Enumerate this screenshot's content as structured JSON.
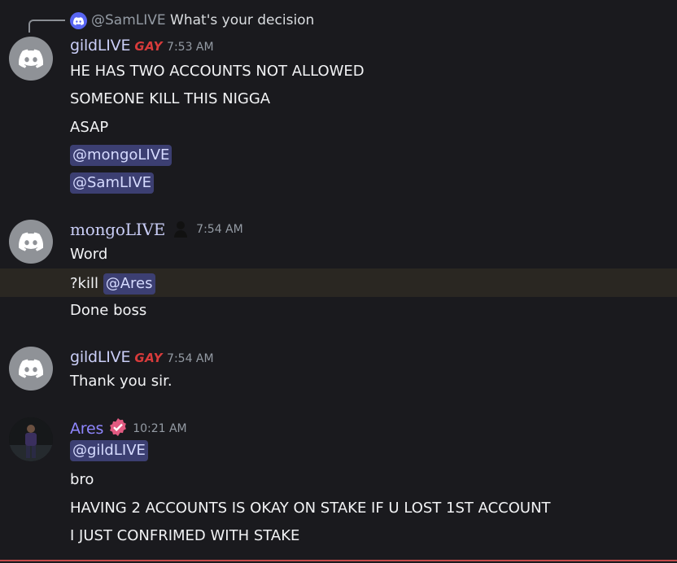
{
  "reply": {
    "mention": "@SamLIVE",
    "text": "What's your decision"
  },
  "messages": [
    {
      "author": "gildLIVE",
      "badge": "GAY",
      "time": "7:53 AM",
      "lines": [
        "HE HAS TWO ACCOUNTS NOT ALLOWED",
        "SOMEONE KILL THIS NIGGA",
        "ASAP"
      ],
      "mentions": [
        "@mongoLIVE",
        "@SamLIVE"
      ]
    },
    {
      "author": "mongoLIVE",
      "time": "7:54 AM",
      "lines": [
        "Word",
        "?kill",
        "Done boss"
      ],
      "mention": "@Ares"
    },
    {
      "author": "gildLIVE",
      "badge": "GAY",
      "time": "7:54 AM",
      "lines": [
        "Thank you sir."
      ]
    },
    {
      "author": "Ares",
      "time": "10:21 AM",
      "mention": "@gildLIVE",
      "lines": [
        "bro",
        "HAVING 2 ACCOUNTS IS OKAY ON STAKE IF U LOST 1ST ACCOUNT",
        "I JUST CONFRIMED WITH STAKE"
      ]
    }
  ],
  "colors": {
    "background": "#1a1a1e",
    "mention_bg": "#3c3f72",
    "username": "#c9cdf6",
    "ares_name": "#8f86ff",
    "highlight_row": "#2a2722",
    "divider": "#c34a4a"
  },
  "icons": [
    "discord-logo-icon",
    "silhouette-icon",
    "verified-badge-icon"
  ]
}
